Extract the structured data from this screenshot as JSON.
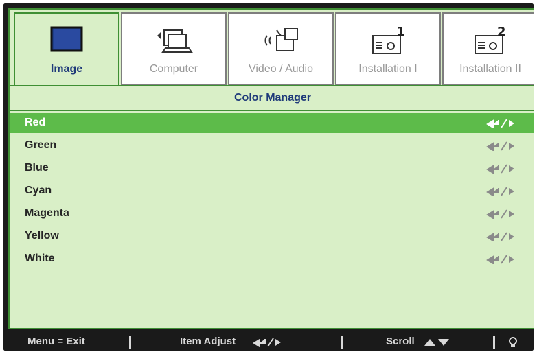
{
  "tabs": [
    {
      "label": "Image",
      "icon": "monitor-icon",
      "active": true
    },
    {
      "label": "Computer",
      "icon": "computer-icon",
      "active": false
    },
    {
      "label": "Video / Audio",
      "icon": "video-audio-icon",
      "active": false
    },
    {
      "label": "Installation I",
      "icon": "installation-1-icon",
      "active": false
    },
    {
      "label": "Installation II",
      "icon": "installation-2-icon",
      "active": false
    }
  ],
  "menu": {
    "title": "Color Manager",
    "items": [
      {
        "label": "Red",
        "selected": true
      },
      {
        "label": "Green",
        "selected": false
      },
      {
        "label": "Blue",
        "selected": false
      },
      {
        "label": "Cyan",
        "selected": false
      },
      {
        "label": "Magenta",
        "selected": false
      },
      {
        "label": "Yellow",
        "selected": false
      },
      {
        "label": "White",
        "selected": false
      }
    ]
  },
  "statusbar": {
    "exit": "Menu = Exit",
    "adjust": "Item Adjust",
    "scroll": "Scroll",
    "hint_icon": "lightbulb-icon"
  },
  "colors": {
    "accent_green": "#3f8f34",
    "selected_row": "#5dbb4a",
    "menu_bg": "#d9efc7",
    "title_blue": "#1f3a7a"
  }
}
